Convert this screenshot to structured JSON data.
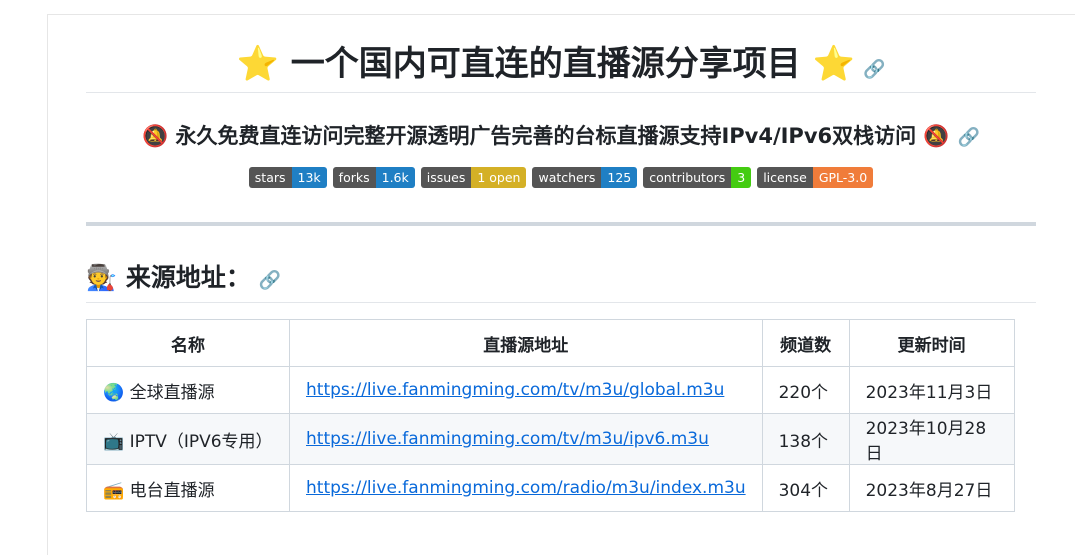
{
  "title": "⭐ 一个国内可直连的直播源分享项目 ⭐",
  "subtitle": "🔕 永久免费直连访问完整开源透明广告完善的台标直播源支持IPv4/IPv6双栈访问 🔕",
  "link_icon": "🔗",
  "badges": [
    {
      "key": "stars",
      "value": "13k",
      "color": "#1f7fc4"
    },
    {
      "key": "forks",
      "value": "1.6k",
      "color": "#1f7fc4"
    },
    {
      "key": "issues",
      "value": "1 open",
      "color": "#d4b026"
    },
    {
      "key": "watchers",
      "value": "125",
      "color": "#1f7fc4"
    },
    {
      "key": "contributors",
      "value": "3",
      "color": "#44cc11"
    },
    {
      "key": "license",
      "value": "GPL-3.0",
      "color": "#f07c3a"
    }
  ],
  "section_title": "🧑‍🏭 来源地址：",
  "table": {
    "headers": [
      "名称",
      "直播源地址",
      "频道数",
      "更新时间"
    ],
    "rows": [
      [
        "🌏 全球直播源",
        "https://live.fanmingming.com/tv/m3u/global.m3u",
        "220个",
        "2023年11月3日"
      ],
      [
        "📺 IPTV（IPV6专用）",
        "https://live.fanmingming.com/tv/m3u/ipv6.m3u",
        "138个",
        "2023年10月28日"
      ],
      [
        "📻 电台直播源",
        "https://live.fanmingming.com/radio/m3u/index.m3u",
        "304个",
        "2023年8月27日"
      ]
    ]
  }
}
